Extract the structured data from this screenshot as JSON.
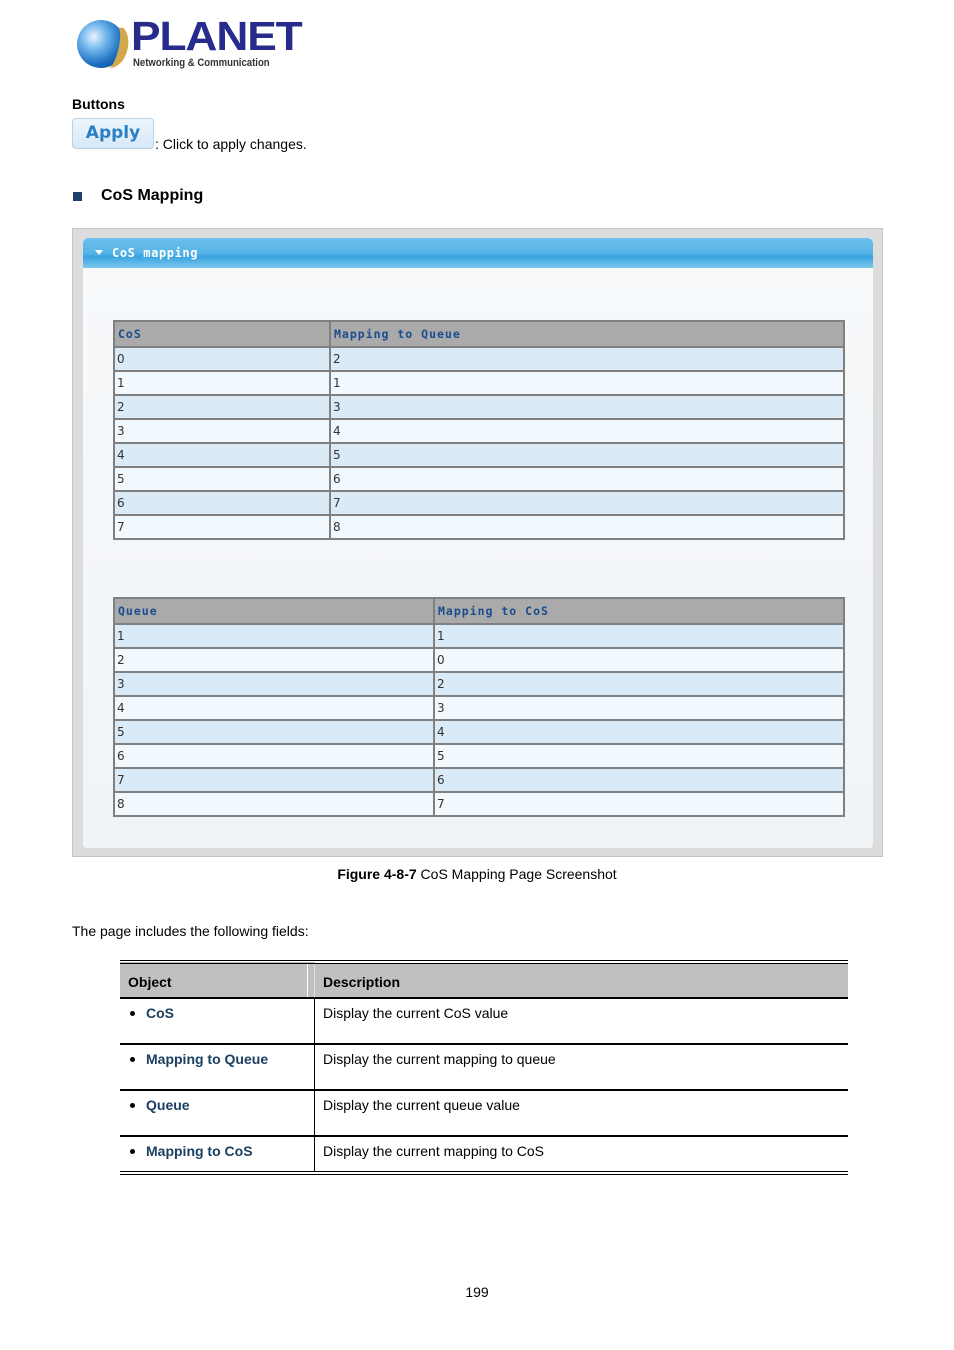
{
  "logo": {
    "brand": "PLANET",
    "tagline": "Networking & Communication",
    "icon": "globe-logo-icon"
  },
  "buttons_section": {
    "heading": "Buttons",
    "apply_label": "Apply",
    "apply_description": ": Click to apply changes."
  },
  "section": {
    "bullet_icon": "square-bullet-icon",
    "title": "CoS Mapping"
  },
  "screenshot": {
    "panel_title": "CoS mapping",
    "panel_icon": "collapse-arrow-icon",
    "cos_table": {
      "headers": [
        "CoS",
        "Mapping to Queue"
      ],
      "rows": [
        [
          "0",
          "2"
        ],
        [
          "1",
          "1"
        ],
        [
          "2",
          "3"
        ],
        [
          "3",
          "4"
        ],
        [
          "4",
          "5"
        ],
        [
          "5",
          "6"
        ],
        [
          "6",
          "7"
        ],
        [
          "7",
          "8"
        ]
      ]
    },
    "queue_table": {
      "headers": [
        "Queue",
        "Mapping to CoS"
      ],
      "rows": [
        [
          "1",
          "1"
        ],
        [
          "2",
          "0"
        ],
        [
          "3",
          "2"
        ],
        [
          "4",
          "3"
        ],
        [
          "5",
          "4"
        ],
        [
          "6",
          "5"
        ],
        [
          "7",
          "6"
        ],
        [
          "8",
          "7"
        ]
      ]
    }
  },
  "figure_caption": {
    "label": "Figure 4-8-7",
    "text": " CoS Mapping Page Screenshot"
  },
  "fields_intro": "The page includes the following fields:",
  "field_table": {
    "headers": [
      "Object",
      "Description"
    ],
    "rows": [
      {
        "object": "CoS",
        "description": "Display the current CoS value"
      },
      {
        "object": "Mapping to Queue",
        "description": "Display the current mapping to queue"
      },
      {
        "object": "Queue",
        "description": "Display the current queue value"
      },
      {
        "object": "Mapping to CoS",
        "description": "Display the current mapping to CoS"
      }
    ]
  },
  "page_number": "199"
}
